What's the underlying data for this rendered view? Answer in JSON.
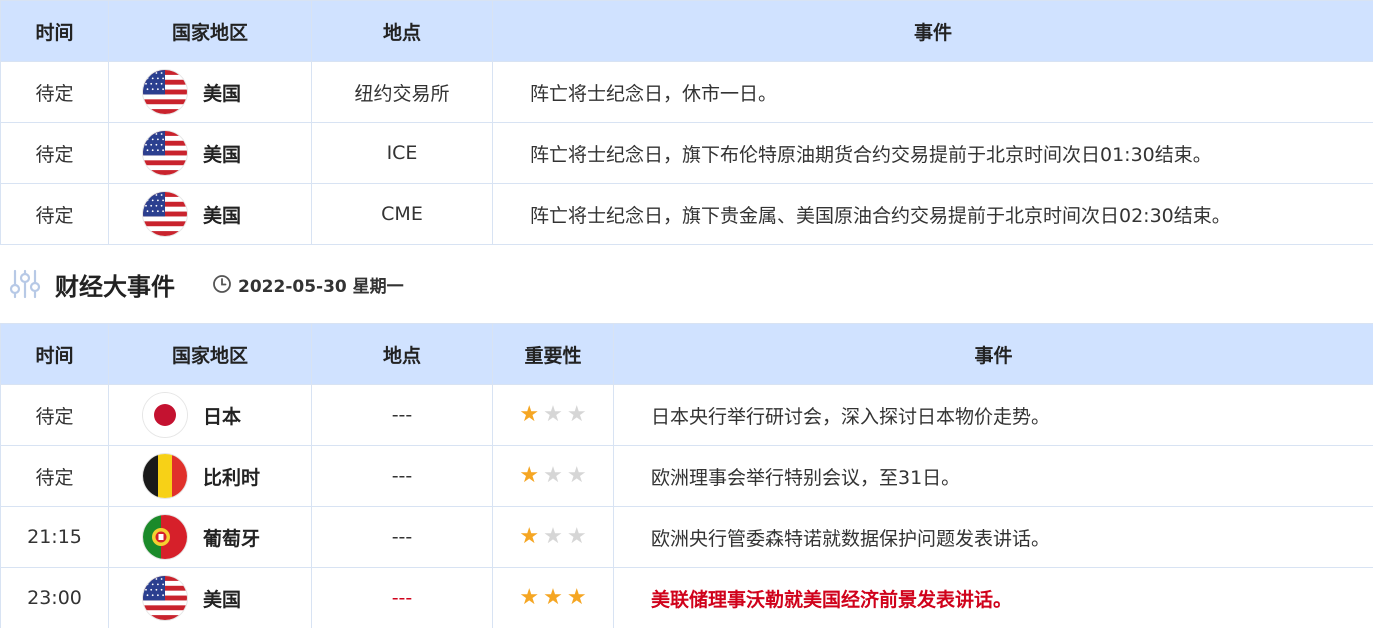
{
  "holiday_table": {
    "headers": [
      "时间",
      "国家地区",
      "地点",
      "事件"
    ],
    "rows": [
      {
        "time": "待定",
        "country": "美国",
        "flag": "us-flag-icon",
        "place": "纽约交易所",
        "event": "阵亡将士纪念日，休市一日。"
      },
      {
        "time": "待定",
        "country": "美国",
        "flag": "us-flag-icon",
        "place": "ICE",
        "event": "阵亡将士纪念日，旗下布伦特原油期货合约交易提前于北京时间次日01:30结束。"
      },
      {
        "time": "待定",
        "country": "美国",
        "flag": "us-flag-icon",
        "place": "CME",
        "event": "阵亡将士纪念日，旗下贵金属、美国原油合约交易提前于北京时间次日02:30结束。"
      }
    ]
  },
  "section": {
    "icon": "sliders-icon",
    "title": "财经大事件",
    "clock_icon": "clock-icon",
    "date": "2022-05-30 星期一"
  },
  "events_table": {
    "headers": [
      "时间",
      "国家地区",
      "地点",
      "重要性",
      "事件"
    ],
    "rows": [
      {
        "time": "待定",
        "country": "日本",
        "flag": "japan-flag-icon",
        "place": "---",
        "importance": 1,
        "event": "日本央行举行研讨会，深入探讨日本物价走势。",
        "highlight": false
      },
      {
        "time": "待定",
        "country": "比利时",
        "flag": "belgium-flag-icon",
        "place": "---",
        "importance": 1,
        "event": "欧洲理事会举行特别会议，至31日。",
        "highlight": false
      },
      {
        "time": "21:15",
        "country": "葡萄牙",
        "flag": "portugal-flag-icon",
        "place": "---",
        "importance": 1,
        "event": "欧洲央行管委森特诺就数据保护问题发表讲话。",
        "highlight": false
      },
      {
        "time": "23:00",
        "country": "美国",
        "flag": "us-flag-icon",
        "place": "---",
        "importance": 3,
        "event": "美联储理事沃勒就美国经济前景发表讲话。",
        "highlight": true
      }
    ]
  },
  "colors": {
    "header_bg": "#d0e2ff",
    "border": "#d8e3f3",
    "star_on": "#f5a623",
    "star_off": "#d6d6d6",
    "highlight": "#d0021b"
  }
}
